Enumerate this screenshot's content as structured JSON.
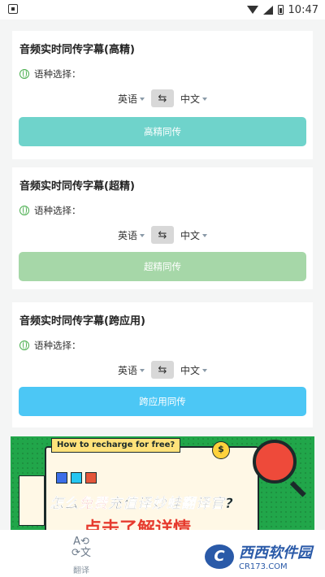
{
  "status": {
    "time": "10:47"
  },
  "cards": [
    {
      "title": "音频实时同传字幕(高精)",
      "lang_label": "语种选择：",
      "source": "英语",
      "target": "中文",
      "button": "高精同传",
      "button_color": "#6fd3cb"
    },
    {
      "title": "音频实时同传字幕(超精)",
      "lang_label": "语种选择：",
      "source": "英语",
      "target": "中文",
      "button": "超精同传",
      "button_color": "#a6d7a8"
    },
    {
      "title": "音频实时同传字幕(跨应用)",
      "lang_label": "语种选择：",
      "source": "英语",
      "target": "中文",
      "button": "跨应用同传",
      "button_color": "#4cc7f5"
    }
  ],
  "banner": {
    "pill": "How to recharge for free?",
    "coin": "$",
    "headline_a": "怎么",
    "headline_red": "免费",
    "headline_b": "充值译妙蛙翻译官?",
    "sub": "点击了解详情"
  },
  "nav": {
    "translate_label": "翻译",
    "translate_icon": "translate-icon"
  },
  "watermark": {
    "logo": "C",
    "name": "西西软件园",
    "url": "CR173.COM"
  },
  "icons": {
    "swap": "⇆",
    "globe": "globe-icon"
  }
}
